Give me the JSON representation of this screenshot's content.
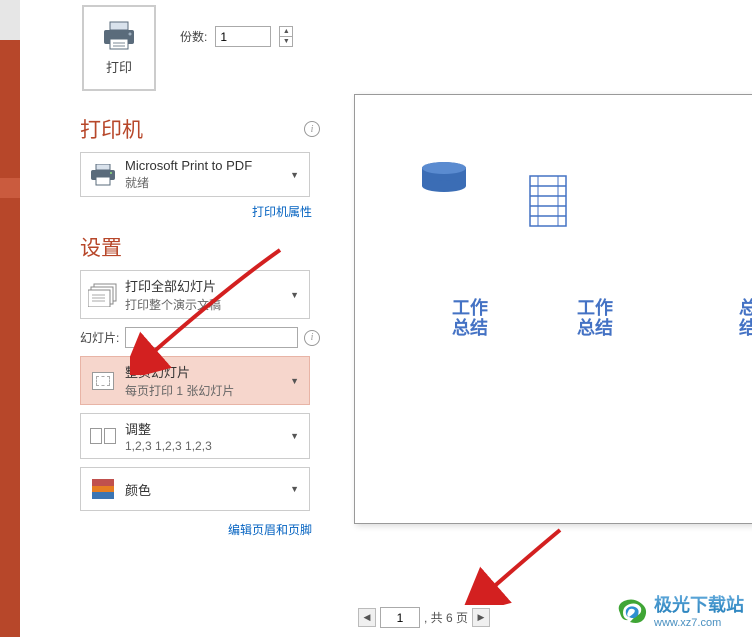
{
  "print_button_label": "打印",
  "copies": {
    "label": "份数:",
    "value": "1"
  },
  "printer": {
    "section_title": "打印机",
    "name": "Microsoft Print to PDF",
    "status": "就绪",
    "properties_link": "打印机属性"
  },
  "settings": {
    "section_title": "设置",
    "print_range": {
      "title": "打印全部幻灯片",
      "sub": "打印整个演示文稿"
    },
    "slides_label": "幻灯片:",
    "slides_value": "",
    "layout": {
      "title": "整页幻灯片",
      "sub": "每页打印 1 张幻灯片"
    },
    "collate": {
      "title": "调整",
      "sub": "1,2,3    1,2,3    1,2,3"
    },
    "color": {
      "title": "颜色"
    },
    "header_footer_link": "编辑页眉和页脚"
  },
  "preview": {
    "text_items": [
      "工作",
      "工作",
      "总",
      "总结",
      "总结",
      "结"
    ]
  },
  "pager": {
    "current": "1",
    "total_text": ", 共 6 页"
  },
  "watermark": {
    "name": "极光下载站",
    "url": "www.xz7.com"
  }
}
